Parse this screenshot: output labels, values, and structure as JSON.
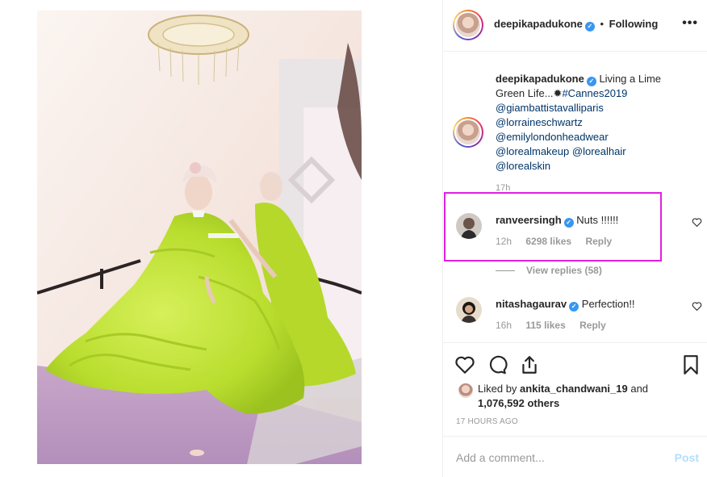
{
  "post": {
    "author": "deepikapadukone",
    "follow_state": "Following",
    "separator": "•",
    "more_icon": "more-horizontal-icon"
  },
  "caption": {
    "username": "deepikapadukone",
    "text_lines": [
      "Living a Lime",
      "Green Life...",
      "#Cannes2019"
    ],
    "sparkle": "✹",
    "mentions": [
      "@giambattistavalliparis",
      "@lorraineschwartz",
      "@emilylondonheadwear",
      "@lorealmakeup",
      "@lorealhair",
      "@lorealskin"
    ],
    "time": "17h"
  },
  "comments": [
    {
      "username": "ranveersingh",
      "text": "Nuts !!!!!!",
      "time": "12h",
      "likes": "6298 likes",
      "reply": "Reply"
    },
    {
      "username": "nitashagaurav",
      "text": "Perfection!!",
      "time": "16h",
      "likes": "115 likes",
      "reply": "Reply"
    }
  ],
  "view_replies": "View replies (58)",
  "likes": {
    "prefix": "Liked by",
    "user": "ankita_chandwani_19",
    "and": "and",
    "others": "1,076,592 others"
  },
  "timestamp": "17 HOURS AGO",
  "add_comment": {
    "placeholder": "Add a comment...",
    "post_label": "Post"
  },
  "colors": {
    "verified": "#3897f0",
    "link": "#003569",
    "highlight": "#e020e0",
    "post_disabled": "#b2dffc"
  }
}
